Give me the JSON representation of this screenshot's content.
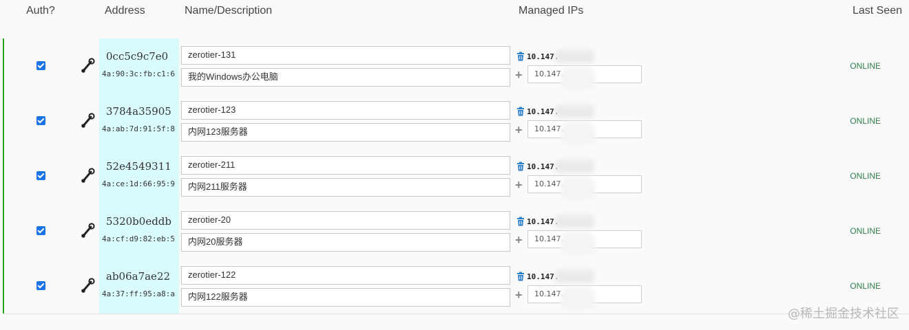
{
  "headers": {
    "auth": "Auth?",
    "address": "Address",
    "name": "Name/Description",
    "ips": "Managed IPs",
    "seen": "Last Seen"
  },
  "rows": [
    {
      "auth": true,
      "node_id": "0cc5c9c7e0",
      "mac": "4a:90:3c:fb:c1:6",
      "name": "zerotier-131",
      "description": "我的Windows办公电脑",
      "ip": "10.147.",
      "ip_input": "10.147.",
      "status": "ONLINE"
    },
    {
      "auth": true,
      "node_id": "3784a35905",
      "mac": "4a:ab:7d:91:5f:8",
      "name": "zerotier-123",
      "description": "内网123服务器",
      "ip": "10.147.",
      "ip_input": "10.147.",
      "status": "ONLINE"
    },
    {
      "auth": true,
      "node_id": "52e4549311",
      "mac": "4a:ce:1d:66:95:9",
      "name": "zerotier-211",
      "description": "内网211服务器",
      "ip": "10.147.",
      "ip_input": "10.147.",
      "status": "ONLINE"
    },
    {
      "auth": true,
      "node_id": "5320b0eddb",
      "mac": "4a:cf:d9:82:eb:5",
      "name": "zerotier-20",
      "description": "内网20服务器",
      "ip": "10.147.",
      "ip_input": "10.147.",
      "status": "ONLINE"
    },
    {
      "auth": true,
      "node_id": "ab06a7ae22",
      "mac": "4a:37:ff:95:a8:a",
      "name": "zerotier-122",
      "description": "内网122服务器",
      "ip": "10.147.",
      "ip_input": "10.147.",
      "status": "ONLINE"
    }
  ],
  "icons": {
    "checkbox": "checkbox-checked-icon",
    "wrench": "wrench-icon",
    "trash": "trash-icon",
    "plus": "plus-icon"
  },
  "colors": {
    "accent": "#1a73e8",
    "online": "#2e7d4f",
    "address_bg": "#d9fbfb",
    "row_accent": "#1ea51e"
  },
  "watermark": "@稀土掘金技术社区"
}
